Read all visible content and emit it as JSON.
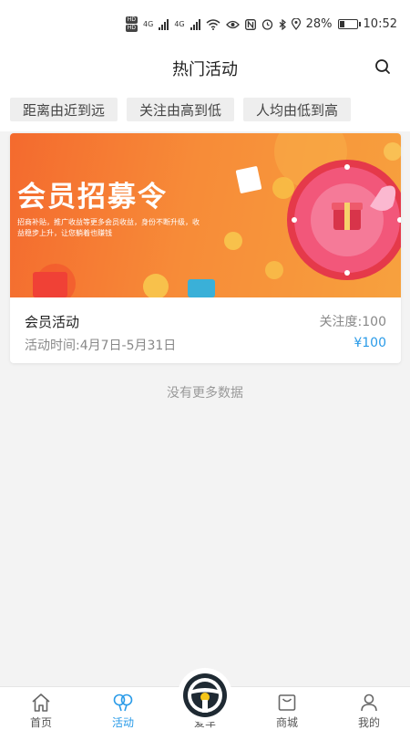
{
  "status": {
    "net_badge_1": "HD",
    "net_badge_2": "HD",
    "net_type_1": "4G",
    "net_type_2": "4G",
    "battery": "28%",
    "time": "10:52",
    "battery_level": 0.28
  },
  "header": {
    "title": "热门活动"
  },
  "filters": [
    "距离由近到远",
    "关注由高到低",
    "人均由低到高"
  ],
  "card": {
    "banner": {
      "title": "会员招募令",
      "subtitle": "招商补贴，推广收益等更多会员收益，身份不断升级，收益稳步上升，让您躺着也赚钱"
    },
    "name": "会员活动",
    "follow": "关注度:100",
    "time": "活动时间:4月7日-5月31日",
    "price": "¥100"
  },
  "footer_note": "没有更多数据",
  "tabs": [
    {
      "label": "首页",
      "icon": "home-icon"
    },
    {
      "label": "活动",
      "icon": "activity-icon",
      "active": true
    },
    {
      "label": "爱车",
      "icon": "steering-wheel-icon"
    },
    {
      "label": "商城",
      "icon": "shop-icon"
    },
    {
      "label": "我的",
      "icon": "user-icon"
    }
  ],
  "colors": {
    "accent": "#2a9be8",
    "banner": "#f46a2e"
  }
}
